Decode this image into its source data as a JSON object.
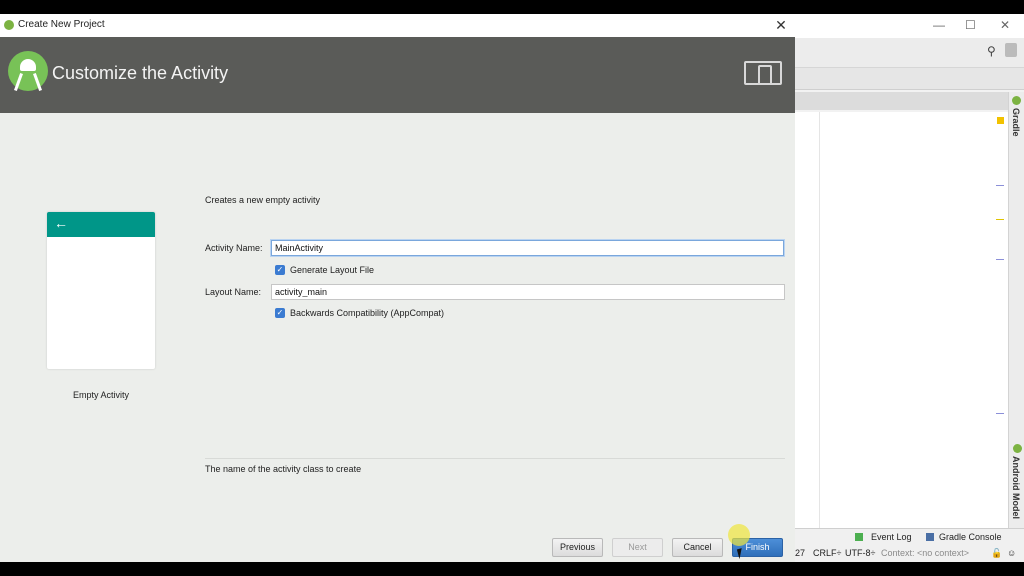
{
  "dialog": {
    "title": "Create New Project",
    "close_label": "✕",
    "header_title": "Customize the Activity",
    "description": "Creates a new empty activity",
    "activity_name_label": "Activity Name:",
    "activity_name_value": "MainActivity",
    "generate_layout_label": "Generate Layout File",
    "generate_layout_checked": true,
    "layout_name_label": "Layout Name:",
    "layout_name_value": "activity_main",
    "backwards_compat_label": "Backwards Compatibility (AppCompat)",
    "backwards_compat_checked": true,
    "preview_label": "Empty Activity",
    "help_text": "The name of the activity class to create",
    "buttons": {
      "previous": "Previous",
      "next": "Next",
      "cancel": "Cancel",
      "finish": "Finish"
    }
  },
  "ide": {
    "window_min": "—",
    "window_max": "☐",
    "window_close": "✕",
    "gradle_label": "Gradle",
    "android_model_label": "Android Model",
    "status": {
      "line": "27",
      "crlf": "CRLF÷",
      "encoding": "UTF-8÷",
      "context": "Context: <no context>",
      "event_log": "Event Log",
      "gradle_console": "Gradle Console"
    }
  },
  "colors": {
    "header_bg": "#5a5b58",
    "accent_teal": "#009688",
    "android_green": "#78c257",
    "primary_blue": "#3b7bd1"
  }
}
